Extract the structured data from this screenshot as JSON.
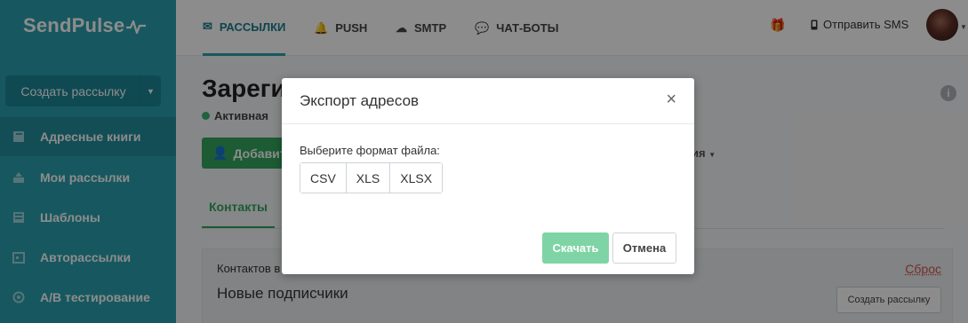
{
  "app": {
    "logo_text": "SendPulse"
  },
  "sidebar": {
    "create_button": "Создать рассылку",
    "items": [
      {
        "label": "Адресные книги",
        "icon": "book-icon",
        "active": true
      },
      {
        "label": "Мои рассылки",
        "icon": "send-icon"
      },
      {
        "label": "Шаблоны",
        "icon": "template-icon"
      },
      {
        "label": "Авторассылки",
        "icon": "calendar-icon"
      },
      {
        "label": "A/B тестирование",
        "icon": "ab-test-icon"
      }
    ]
  },
  "topnav": {
    "tabs": [
      {
        "label": "РАССЫЛКИ",
        "icon": "envelope-icon",
        "active": true
      },
      {
        "label": "PUSH",
        "icon": "bell-icon"
      },
      {
        "label": "SMTP",
        "icon": "cloud-icon"
      },
      {
        "label": "ЧАТ-БОТЫ",
        "icon": "chat-icon"
      }
    ],
    "sms_label": "Отправить SMS"
  },
  "page": {
    "title": "Зарегистрированные пользователи",
    "status": "Активная",
    "add_button": "Добавить",
    "actions_label": "ия",
    "tab_contacts": "Контакты",
    "contacts_label": "Контактов в",
    "new_subscribers": "Новые подписчики",
    "reset_link": "Сброс",
    "create_small_button": "Создать рассылку"
  },
  "modal": {
    "title": "Экспорт адресов",
    "format_label": "Выберите формат файла:",
    "formats": [
      "CSV",
      "XLS",
      "XLSX"
    ],
    "download_button": "Скачать",
    "cancel_button": "Отмена"
  },
  "colors": {
    "sidebar": "#2aa1b0",
    "accent_green": "#34a65f",
    "download_disabled": "#7fd4a5",
    "danger": "#d9534f"
  }
}
